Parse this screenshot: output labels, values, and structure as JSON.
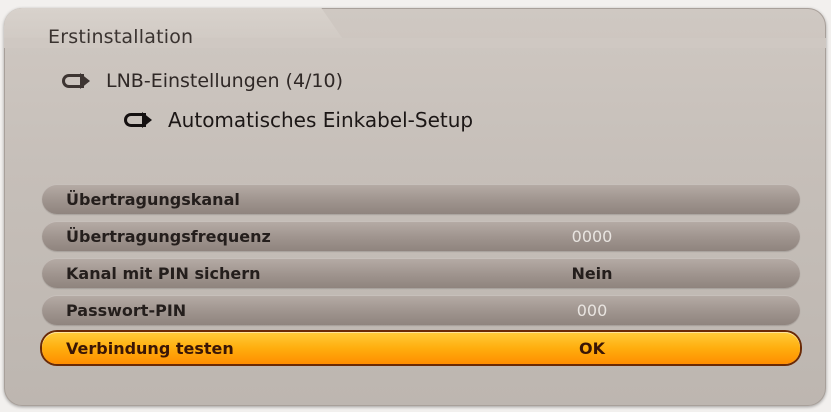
{
  "header": {
    "title": "Erstinstallation",
    "breadcrumb_1": "LNB-Einstellungen (4/10)",
    "breadcrumb_2": "Automatisches Einkabel-Setup"
  },
  "menu": {
    "rows": [
      {
        "label": "Übertragungskanal",
        "value": ""
      },
      {
        "label": "Übertragungsfrequenz",
        "value": "0000"
      },
      {
        "label": "Kanal mit PIN sichern",
        "value": "Nein"
      },
      {
        "label": "Passwort-PIN",
        "value": "000"
      },
      {
        "label": "Verbindung testen",
        "value": "OK"
      }
    ],
    "selected_index": 4
  },
  "colors": {
    "panel": "#c6bfb9",
    "row": "#9f948e",
    "highlight": "#ffae0e",
    "highlight_border": "#6a2a06"
  },
  "icons": [
    "arrow-return-icon"
  ]
}
